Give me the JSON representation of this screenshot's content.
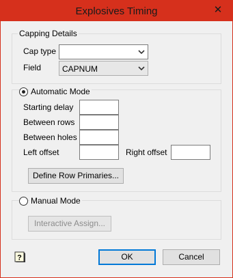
{
  "window": {
    "title": "Explosives Timing",
    "close_glyph": "✕"
  },
  "capping": {
    "title": "Capping Details",
    "cap_type_label": "Cap type",
    "cap_type_value": "",
    "field_label": "Field",
    "field_value": "CAPNUM"
  },
  "automatic": {
    "title": "Automatic Mode",
    "selected": true,
    "starting_delay_label": "Starting delay",
    "between_rows_label": "Between rows",
    "between_holes_label": "Between holes",
    "left_offset_label": "Left offset",
    "right_offset_label": "Right offset",
    "define_button": "Define Row Primaries..."
  },
  "manual": {
    "title": "Manual Mode",
    "selected": false,
    "interactive_button": "Interactive Assign..."
  },
  "footer": {
    "ok": "OK",
    "cancel": "Cancel"
  },
  "icons": [
    "close-icon",
    "chevron-down-icon",
    "help-icon"
  ]
}
